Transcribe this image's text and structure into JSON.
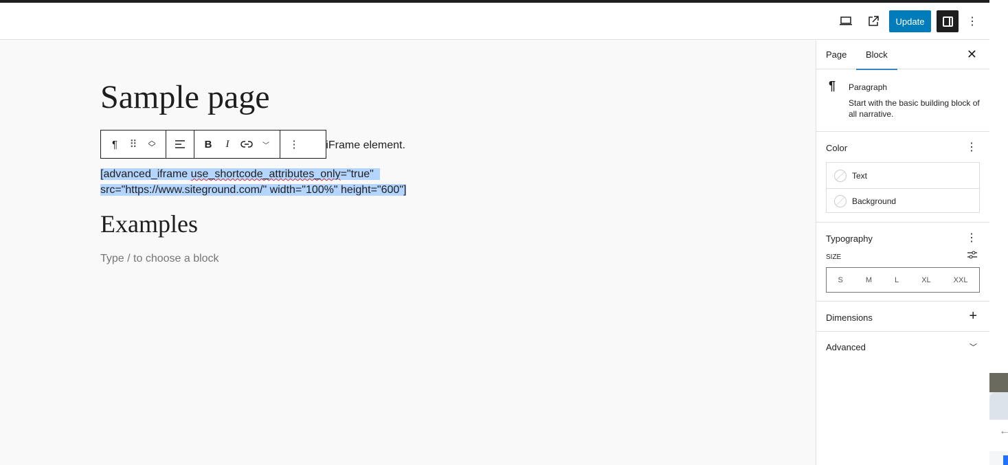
{
  "topbar": {
    "update_label": "Update",
    "icons": [
      "desktop-preview-icon",
      "external-link-icon",
      "sidebar-toggle-icon",
      "more-vertical-icon"
    ]
  },
  "editor": {
    "title": "Sample page",
    "paragraph_visible": "d iFrame element.",
    "shortcode_line1_a": "[advanced_iframe ",
    "shortcode_line1_b": "use_shortcode_attributes_only",
    "shortcode_line1_c": "=\"true\"",
    "shortcode_line2": "src=\"https://www.siteground.com/\" width=\"100%\" height=\"600\"]",
    "heading": "Examples",
    "placeholder": "Type / to choose a block"
  },
  "sidebar": {
    "tabs": [
      "Page",
      "Block"
    ],
    "active_tab": "Block",
    "block": {
      "name": "Paragraph",
      "description": "Start with the basic building block of all narrative."
    },
    "color": {
      "title": "Color",
      "items": [
        "Text",
        "Background"
      ]
    },
    "typography": {
      "title": "Typography",
      "size_label": "SIZE",
      "sizes": [
        "S",
        "M",
        "L",
        "XL",
        "XXL"
      ]
    },
    "dimensions": {
      "title": "Dimensions"
    },
    "advanced": {
      "title": "Advanced"
    }
  },
  "colors": {
    "accent": "#007cba",
    "selection": "#b4d5fe"
  }
}
